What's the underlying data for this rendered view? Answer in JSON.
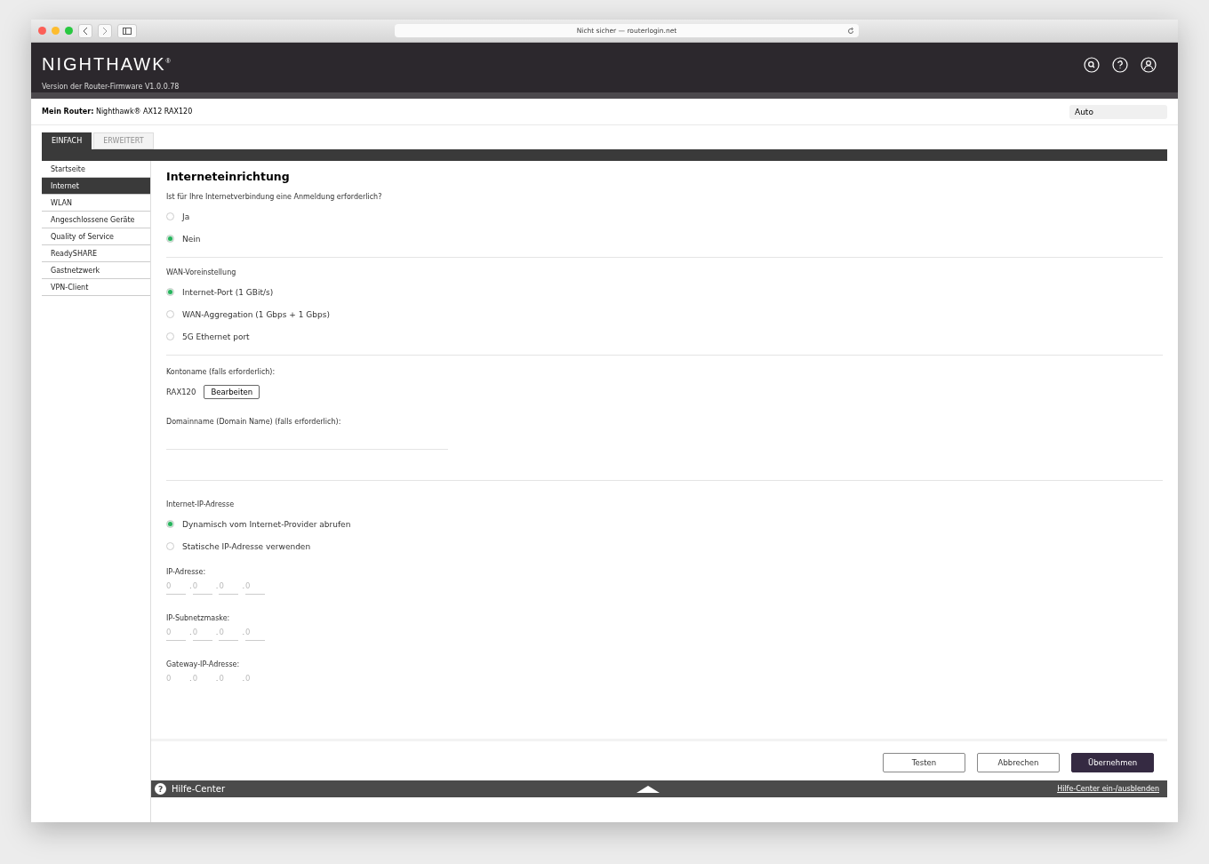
{
  "browser": {
    "address": "Nicht sicher — routerlogin.net"
  },
  "header": {
    "logo": "NIGHTHAWK",
    "trademark": "®",
    "firmware": "Version der Router-Firmware V1.0.0.78"
  },
  "router": {
    "label": "Mein Router:",
    "name": "Nighthawk® AX12 RAX120",
    "language": "Auto"
  },
  "tabs": [
    {
      "label": "EINFACH",
      "selected": true
    },
    {
      "label": "ERWEITERT",
      "selected": false
    }
  ],
  "sidebar": {
    "items": [
      {
        "label": "Startseite",
        "selected": false
      },
      {
        "label": "Internet",
        "selected": true
      },
      {
        "label": "WLAN",
        "selected": false
      },
      {
        "label": "Angeschlossene Geräte",
        "selected": false
      },
      {
        "label": "Quality of Service",
        "selected": false
      },
      {
        "label": "ReadySHARE",
        "selected": false
      },
      {
        "label": "Gastnetzwerk",
        "selected": false
      },
      {
        "label": "VPN-Client",
        "selected": false
      }
    ]
  },
  "page": {
    "title": "Interneteinrichtung",
    "sections": [
      {
        "kind": "radio",
        "label": "Ist für Ihre Internetverbindung eine Anmeldung erforderlich?",
        "options": [
          {
            "label": "Ja",
            "selected": false
          },
          {
            "label": "Nein",
            "selected": true
          }
        ]
      },
      {
        "kind": "radio",
        "label": "WAN-Voreinstellung",
        "options": [
          {
            "label": "Internet-Port (1 GBit/s)",
            "selected": true
          },
          {
            "label": "WAN-Aggregation (1 Gbps + 1 Gbps)",
            "selected": false
          },
          {
            "label": "5G Ethernet port",
            "selected": false
          }
        ]
      },
      {
        "kind": "account",
        "label": "Kontoname  (falls erforderlich):",
        "value": "RAX120",
        "button": "Bearbeiten",
        "domain_label": "Domainname  (Domain Name) (falls erforderlich):"
      },
      {
        "kind": "ip",
        "label": "Internet-IP-Adresse",
        "options": [
          {
            "label": "Dynamisch vom Internet-Provider abrufen",
            "selected": true
          },
          {
            "label": "Statische IP-Adresse verwenden",
            "selected": false
          }
        ],
        "fields": [
          {
            "label": "IP-Adresse:",
            "underlined": true,
            "octets": [
              {
                "placeholder": "0"
              },
              {
                "prefix": ".",
                "placeholder": "0"
              },
              {
                "prefix": ".",
                "placeholder": "0"
              },
              {
                "prefix": ".",
                "placeholder": "0"
              }
            ]
          },
          {
            "label": "IP-Subnetzmaske:",
            "underlined": true,
            "octets": [
              {
                "placeholder": "0"
              },
              {
                "prefix": ".",
                "placeholder": "0"
              },
              {
                "prefix": ".",
                "placeholder": "0"
              },
              {
                "prefix": ".",
                "placeholder": "0"
              }
            ]
          },
          {
            "label": "Gateway-IP-Adresse:",
            "underlined": false,
            "octets": [
              {
                "placeholder": "0"
              },
              {
                "prefix": ".",
                "placeholder": "0"
              },
              {
                "prefix": ".",
                "placeholder": "0"
              },
              {
                "prefix": ".",
                "placeholder": "0"
              }
            ]
          }
        ]
      }
    ],
    "buttons": [
      {
        "label": "Testen",
        "primary": false
      },
      {
        "label": "Abbrechen",
        "primary": false
      },
      {
        "label": "Übernehmen",
        "primary": true
      }
    ]
  },
  "help_bar": {
    "icon": "?",
    "label": "Hilfe-Center",
    "link": "Hilfe-Center ein-/ausblenden"
  }
}
